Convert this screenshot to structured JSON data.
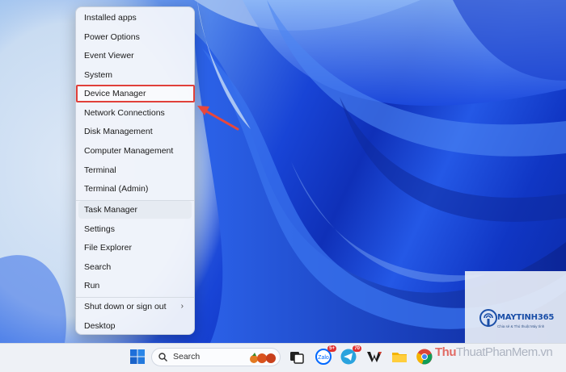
{
  "menu": {
    "items": [
      {
        "label": "Installed apps"
      },
      {
        "label": "Power Options"
      },
      {
        "label": "Event Viewer"
      },
      {
        "label": "System"
      },
      {
        "label": "Device Manager"
      },
      {
        "label": "Network Connections"
      },
      {
        "label": "Disk Management"
      },
      {
        "label": "Computer Management"
      },
      {
        "label": "Terminal"
      },
      {
        "label": "Terminal (Admin)"
      },
      {
        "label": "Task Manager"
      },
      {
        "label": "Settings"
      },
      {
        "label": "File Explorer"
      },
      {
        "label": "Search"
      },
      {
        "label": "Run"
      },
      {
        "label": "Shut down or sign out"
      },
      {
        "label": "Desktop"
      }
    ],
    "highlighted_item": "Device Manager",
    "hovered_item": "Task Manager",
    "highlight_color": "#e0403a"
  },
  "taskbar": {
    "search_label": "Search",
    "badges": {
      "zalo": "5+",
      "telegram": "70"
    },
    "icons": [
      "windows-start-icon",
      "search-icon",
      "widgets-icon",
      "task-view-icon",
      "zalo-icon",
      "telegram-icon",
      "w-app-icon",
      "file-explorer-icon",
      "chrome-icon"
    ]
  },
  "watermark": {
    "brand": "MAYTINH365",
    "tagline": "Chia sẻ & Thủ thuật Máy tính",
    "overlay_text_red": "Thu",
    "overlay_text_rest": "ThuatPhanMem.vn"
  }
}
